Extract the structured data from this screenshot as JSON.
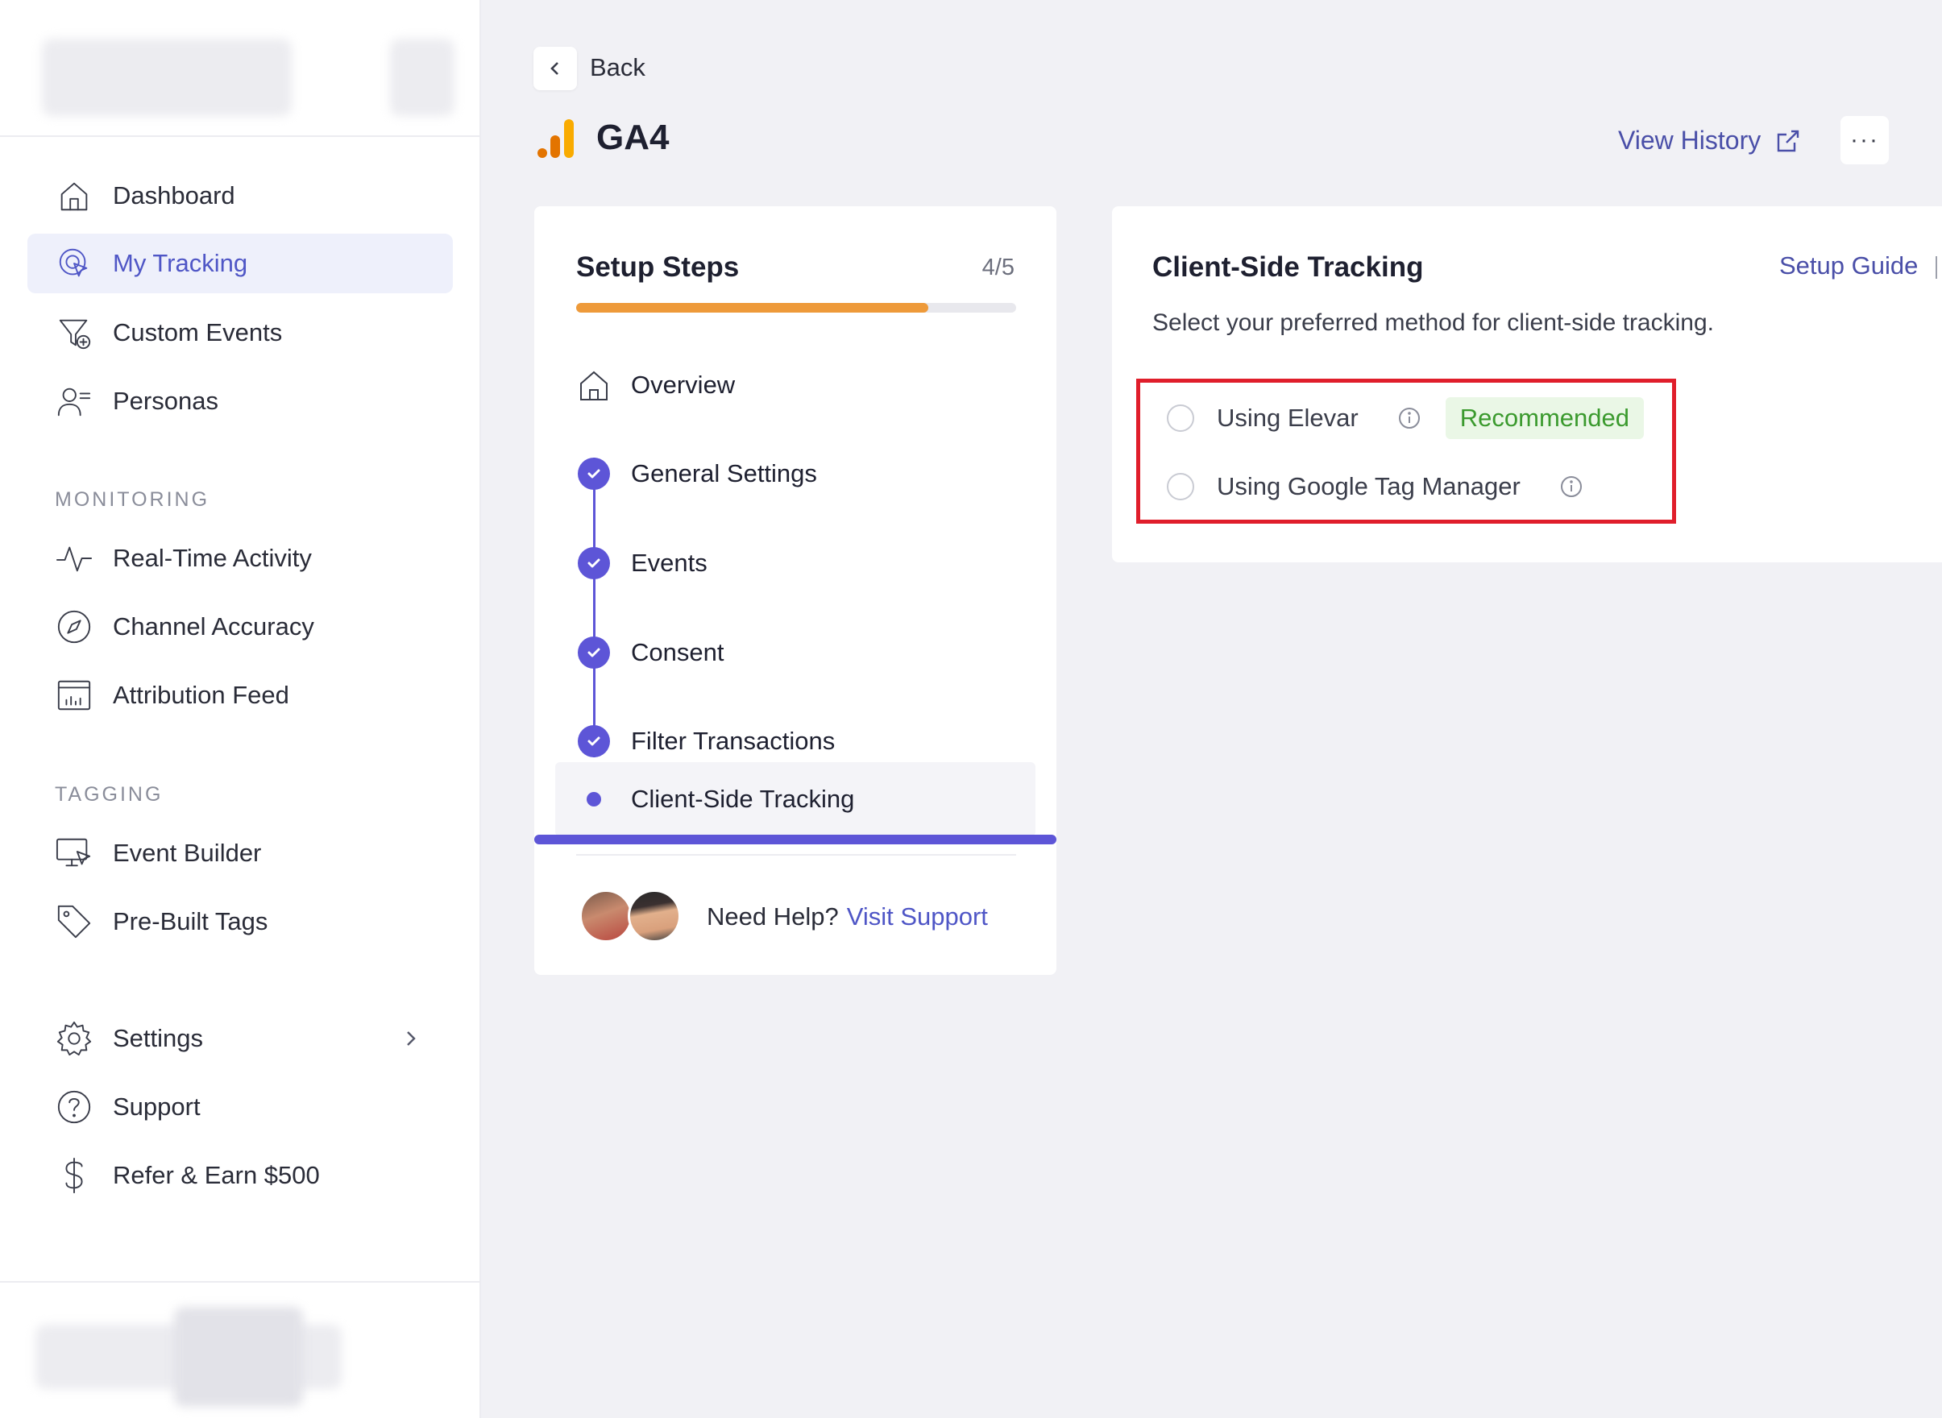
{
  "sidebar": {
    "items": [
      {
        "label": "Dashboard",
        "icon": "home-icon"
      },
      {
        "label": "My Tracking",
        "icon": "tracking-icon",
        "active": true
      },
      {
        "label": "Custom Events",
        "icon": "funnel-plus-icon"
      },
      {
        "label": "Personas",
        "icon": "persona-icon"
      }
    ],
    "monitoring_label": "MONITORING",
    "monitoring": [
      {
        "label": "Real-Time Activity",
        "icon": "activity-icon"
      },
      {
        "label": "Channel Accuracy",
        "icon": "compass-icon"
      },
      {
        "label": "Attribution Feed",
        "icon": "chart-calendar-icon"
      }
    ],
    "tagging_label": "TAGGING",
    "tagging": [
      {
        "label": "Event Builder",
        "icon": "monitor-cursor-icon"
      },
      {
        "label": "Pre-Built Tags",
        "icon": "tag-icon"
      }
    ],
    "bottom": [
      {
        "label": "Settings",
        "icon": "gear-icon"
      },
      {
        "label": "Support",
        "icon": "question-icon"
      },
      {
        "label": "Refer & Earn $500",
        "icon": "dollar-icon"
      }
    ]
  },
  "header": {
    "back_label": "Back",
    "title": "GA4",
    "view_history": "View History",
    "more": "···"
  },
  "steps": {
    "title": "Setup Steps",
    "count": "4/5",
    "progress": 0.8,
    "items": [
      {
        "label": "Overview",
        "state": "home"
      },
      {
        "label": "General Settings",
        "state": "done"
      },
      {
        "label": "Events",
        "state": "done"
      },
      {
        "label": "Consent",
        "state": "done"
      },
      {
        "label": "Filter Transactions",
        "state": "done"
      },
      {
        "label": "Client-Side Tracking",
        "state": "current"
      }
    ],
    "help_text": "Need Help?",
    "help_link": "Visit Support"
  },
  "client_side": {
    "title": "Client-Side Tracking",
    "guide": "Setup Guide",
    "description": "Select your preferred method for client-side tracking.",
    "options": [
      {
        "label": "Using Elevar",
        "badge": "Recommended"
      },
      {
        "label": "Using Google Tag Manager"
      }
    ]
  },
  "colors": {
    "accent": "#5d55d7",
    "progress": "#ee9a3a",
    "highlight": "#e01e2b"
  }
}
